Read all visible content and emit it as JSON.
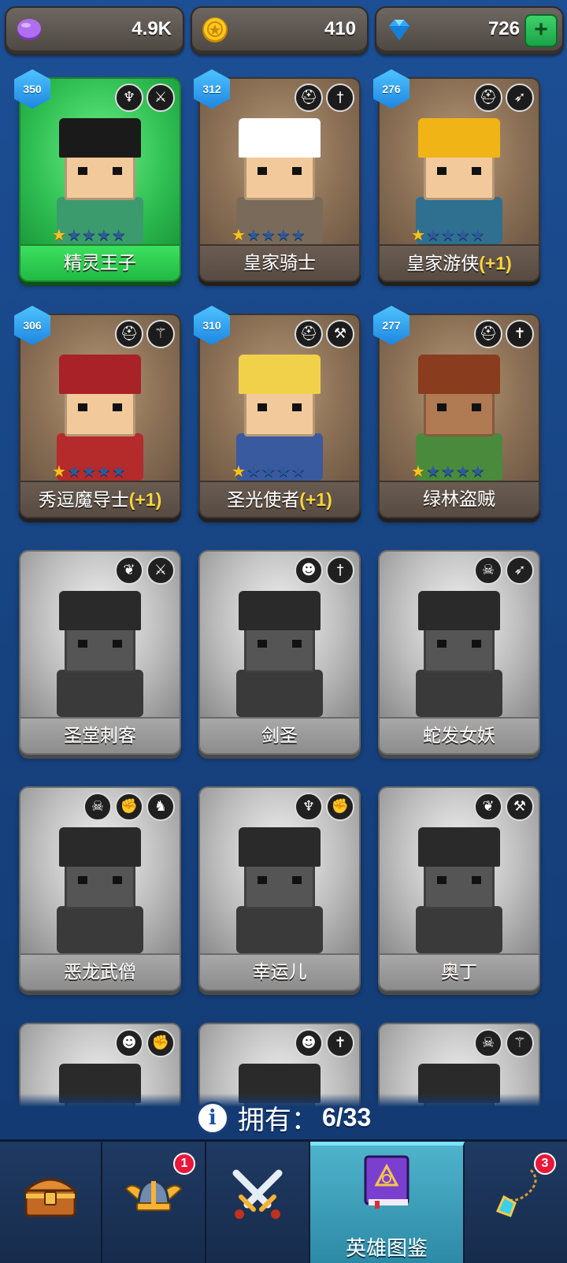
{
  "currencies": [
    {
      "name": "gems-purple",
      "value": "4.9K",
      "icon": "purple-gem-icon",
      "color": "#a25be0"
    },
    {
      "name": "gold",
      "value": "410",
      "icon": "gold-coin-icon",
      "color": "#f5b800"
    },
    {
      "name": "diamonds",
      "value": "726",
      "icon": "blue-diamond-icon",
      "color": "#4fc7ff",
      "has_plus": true,
      "plus": "+"
    }
  ],
  "heroes": [
    {
      "name": "精灵王子",
      "suffix": "",
      "level": "350",
      "stars": 1,
      "total_stars": 5,
      "state": "selected",
      "badges": [
        "elf-icon",
        "sword-slash-icon"
      ]
    },
    {
      "name": "皇家骑士",
      "suffix": "",
      "level": "312",
      "stars": 1,
      "total_stars": 5,
      "state": "owned",
      "badges": [
        "helmet-icon",
        "sword-icon"
      ]
    },
    {
      "name": "皇家游侠",
      "suffix": "(+1)",
      "level": "276",
      "stars": 1,
      "total_stars": 5,
      "state": "owned",
      "badges": [
        "helmet-icon",
        "bow-icon"
      ]
    },
    {
      "name": "秀逗魔导士",
      "suffix": "(+1)",
      "level": "306",
      "stars": 1,
      "total_stars": 5,
      "state": "owned",
      "badges": [
        "helmet-icon",
        "staff-icon"
      ]
    },
    {
      "name": "圣光使者",
      "suffix": "(+1)",
      "level": "310",
      "stars": 1,
      "total_stars": 5,
      "state": "owned",
      "badges": [
        "helmet-icon",
        "hammer-icon"
      ]
    },
    {
      "name": "绿林盗贼",
      "suffix": "",
      "level": "277",
      "stars": 1,
      "total_stars": 5,
      "state": "owned",
      "badges": [
        "helmet-icon",
        "dagger-icon"
      ]
    },
    {
      "name": "圣堂刺客",
      "suffix": "",
      "level": "",
      "stars": 0,
      "total_stars": 0,
      "state": "locked",
      "badges": [
        "wings-icon",
        "sword-slash-icon"
      ]
    },
    {
      "name": "剑圣",
      "suffix": "",
      "level": "",
      "stars": 0,
      "total_stars": 0,
      "state": "locked",
      "badges": [
        "orc-icon",
        "sword-icon"
      ]
    },
    {
      "name": "蛇发女妖",
      "suffix": "",
      "level": "",
      "stars": 0,
      "total_stars": 0,
      "state": "locked",
      "badges": [
        "skull-icon",
        "bow-icon"
      ]
    },
    {
      "name": "恶龙武僧",
      "suffix": "",
      "level": "",
      "stars": 0,
      "total_stars": 0,
      "state": "locked",
      "badges": [
        "skull-icon",
        "fist-icon",
        "dragon-icon"
      ]
    },
    {
      "name": "幸运儿",
      "suffix": "",
      "level": "",
      "stars": 0,
      "total_stars": 0,
      "state": "locked",
      "badges": [
        "elf-icon",
        "fist-icon"
      ]
    },
    {
      "name": "奥丁",
      "suffix": "",
      "level": "",
      "stars": 0,
      "total_stars": 0,
      "state": "locked",
      "badges": [
        "wings-icon",
        "hammer-icon"
      ]
    },
    {
      "name": "",
      "suffix": "",
      "level": "",
      "stars": 0,
      "total_stars": 0,
      "state": "locked",
      "badges": [
        "orc-icon",
        "fist-icon"
      ]
    },
    {
      "name": "",
      "suffix": "",
      "level": "",
      "stars": 0,
      "total_stars": 0,
      "state": "locked",
      "badges": [
        "orc-icon",
        "dagger-icon"
      ]
    },
    {
      "name": "",
      "suffix": "",
      "level": "",
      "stars": 0,
      "total_stars": 0,
      "state": "locked",
      "badges": [
        "skull-icon",
        "staff-icon"
      ]
    }
  ],
  "owned": {
    "label": "拥有：",
    "count": "6/33",
    "icon": "info-icon"
  },
  "nav": [
    {
      "name": "chest",
      "label": "",
      "icon": "treasure-chest-icon",
      "badge": "",
      "active": false
    },
    {
      "name": "heroes-helmet",
      "label": "",
      "icon": "winged-helmet-icon",
      "badge": "1",
      "active": false
    },
    {
      "name": "battle",
      "label": "",
      "icon": "crossed-swords-icon",
      "badge": "",
      "active": false
    },
    {
      "name": "hero-codex",
      "label": "英雄图鉴",
      "icon": "spellbook-icon",
      "badge": "",
      "active": true
    },
    {
      "name": "amulet",
      "label": "",
      "icon": "amulet-icon",
      "badge": "3",
      "active": false
    }
  ]
}
